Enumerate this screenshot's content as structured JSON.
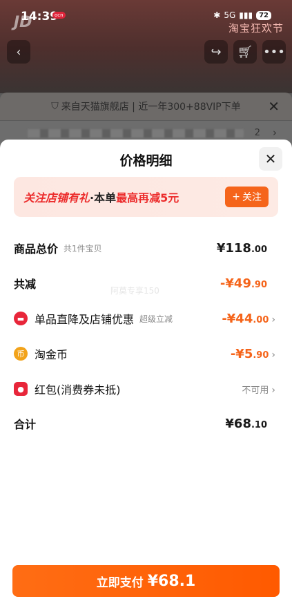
{
  "status_bar": {
    "time": "14:39",
    "small_badge": "ocn",
    "network": "5G",
    "battery": "72"
  },
  "background": {
    "brand_text": "JD",
    "festival_text": "淘宝狂欢节",
    "cart_count": "6",
    "promo_text": "来自天猫旗舰店 | 近一年300+88VIP下单",
    "blurred_count": "2"
  },
  "sheet": {
    "title": "价格明细",
    "banner": {
      "part1": "关注店铺有礼",
      "part2": "·本单",
      "part3": "最高再减5元",
      "follow_label": "关注"
    },
    "rows": {
      "total": {
        "label": "商品总价",
        "sub": "共1件宝贝",
        "value_int": "¥118",
        "value_dec": ".00"
      },
      "discount": {
        "label": "共减",
        "value_int": "-¥49",
        "value_dec": ".90"
      },
      "store": {
        "label": "单品直降及店铺优惠",
        "sub": "超级立减",
        "value_int": "-¥44",
        "value_dec": ".00"
      },
      "coins": {
        "label": "淘金币",
        "value_int": "-¥5",
        "value_dec": ".90"
      },
      "redpacket": {
        "label": "红包(消费券未抵)",
        "value": "不可用"
      },
      "sum": {
        "label": "合计",
        "value_int": "¥68",
        "value_dec": ".10"
      }
    },
    "watermark": "阿莫专享150",
    "pay": {
      "label": "立即支付",
      "amount": "¥68.1"
    }
  },
  "colors": {
    "accent": "#f5641a",
    "red": "#ec2b2b"
  },
  "icons": [
    "back-icon",
    "share-icon",
    "cart-icon",
    "more-icon",
    "shield-icon",
    "close-icon",
    "chevron-right-icon",
    "coin-icon",
    "red-packet-icon",
    "discount-icon"
  ]
}
